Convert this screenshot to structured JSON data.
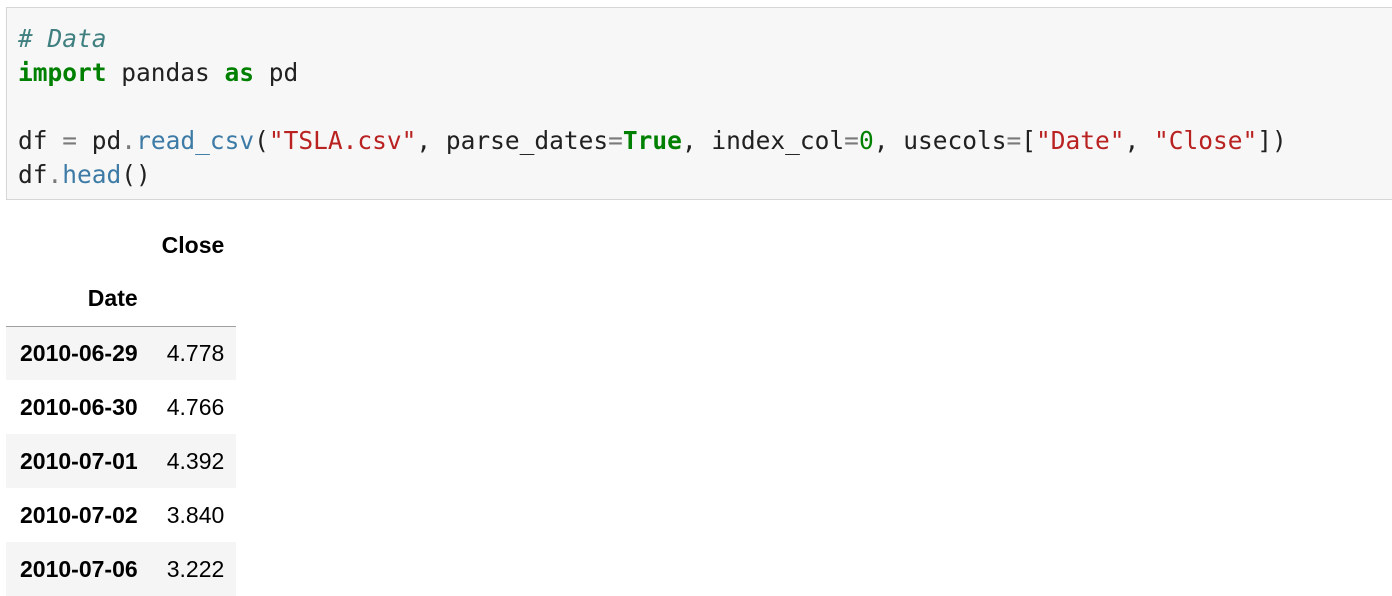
{
  "code_cell": {
    "lines": [
      [
        {
          "t": "comment",
          "v": "# Data"
        }
      ],
      [
        {
          "t": "kw",
          "v": "import"
        },
        {
          "t": "plain",
          "v": " pandas "
        },
        {
          "t": "kw",
          "v": "as"
        },
        {
          "t": "plain",
          "v": " pd"
        }
      ],
      [],
      [
        {
          "t": "plain",
          "v": "df "
        },
        {
          "t": "op",
          "v": "="
        },
        {
          "t": "plain",
          "v": " pd"
        },
        {
          "t": "op",
          "v": "."
        },
        {
          "t": "attr",
          "v": "read_csv"
        },
        {
          "t": "plain",
          "v": "("
        },
        {
          "t": "str",
          "v": "\"TSLA.csv\""
        },
        {
          "t": "plain",
          "v": ", parse_dates"
        },
        {
          "t": "op",
          "v": "="
        },
        {
          "t": "kw",
          "v": "True"
        },
        {
          "t": "plain",
          "v": ", index_col"
        },
        {
          "t": "op",
          "v": "="
        },
        {
          "t": "num",
          "v": "0"
        },
        {
          "t": "plain",
          "v": ", usecols"
        },
        {
          "t": "op",
          "v": "="
        },
        {
          "t": "plain",
          "v": "["
        },
        {
          "t": "str",
          "v": "\"Date\""
        },
        {
          "t": "plain",
          "v": ", "
        },
        {
          "t": "str",
          "v": "\"Close\""
        },
        {
          "t": "plain",
          "v": "])"
        }
      ],
      [
        {
          "t": "plain",
          "v": "df"
        },
        {
          "t": "op",
          "v": "."
        },
        {
          "t": "attr",
          "v": "head"
        },
        {
          "t": "plain",
          "v": "()"
        }
      ]
    ]
  },
  "output_table": {
    "column_header": "Close",
    "index_name": "Date",
    "rows": [
      {
        "index": "2010-06-29",
        "close": "4.778"
      },
      {
        "index": "2010-06-30",
        "close": "4.766"
      },
      {
        "index": "2010-07-01",
        "close": "4.392"
      },
      {
        "index": "2010-07-02",
        "close": "3.840"
      },
      {
        "index": "2010-07-06",
        "close": "3.222"
      }
    ]
  },
  "colors": {
    "cell_background": "#f7f7f7",
    "cell_border": "#d6d6d6",
    "keyword": "#008000",
    "string": "#ba2121",
    "comment": "#408080",
    "table_stripe": "#f5f5f5"
  }
}
